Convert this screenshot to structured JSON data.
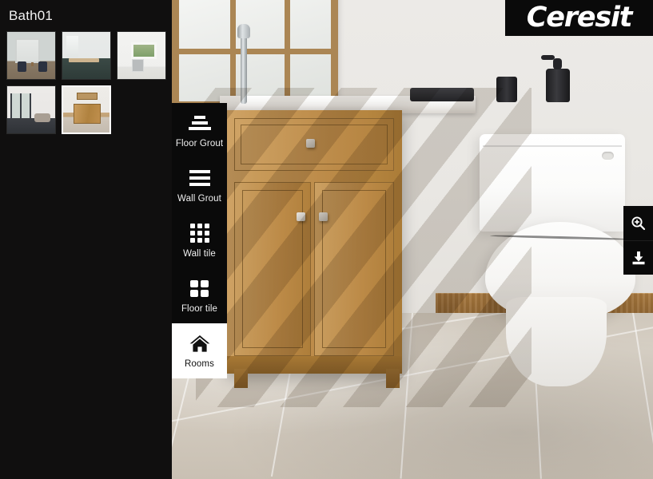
{
  "app": {
    "brand_logo_text": "Ceresit",
    "brand_bg": "#0a0a0a",
    "panel_bg": "#100f0f",
    "accent_active_bg": "#ffffff"
  },
  "sidebar": {
    "room_title": "Bath01",
    "thumbnails": [
      {
        "name": "living-room-fireplace",
        "selected": false,
        "art": "mini-livingroom"
      },
      {
        "name": "kitchen-dining",
        "selected": false,
        "art": "mini-kitchen-dining"
      },
      {
        "name": "white-kitchen",
        "selected": false,
        "art": "mini-white-kitchen"
      },
      {
        "name": "loft-living",
        "selected": false,
        "art": "mini-loft"
      },
      {
        "name": "bathroom-vanity",
        "selected": true,
        "art": "mini-bath"
      }
    ]
  },
  "tool_menu": {
    "items": [
      {
        "label": "Floor Grout",
        "icon": "floor-grout-icon",
        "active": false
      },
      {
        "label": "Wall Grout",
        "icon": "wall-grout-icon",
        "active": false
      },
      {
        "label": "Wall tile",
        "icon": "wall-tile-grid-icon",
        "active": false
      },
      {
        "label": "Floor tile",
        "icon": "floor-tile-grid-icon",
        "active": false
      },
      {
        "label": "Rooms",
        "icon": "home-icon",
        "active": true
      }
    ]
  },
  "right_tools": {
    "items": [
      {
        "name": "zoom-in-button",
        "icon": "magnifier-plus-icon"
      },
      {
        "name": "download-button",
        "icon": "download-icon"
      }
    ]
  },
  "scene": {
    "name": "bathroom-render",
    "description": "Bathroom visualization with wooden vanity, window, toilet and tiled floor",
    "colors": {
      "wall": "#e9e7e3",
      "floor_tile": "#d2cabe",
      "grout": "#ffffff",
      "wood_vanity": "#bd8c4a",
      "baseboard_wood": "#9c6f38",
      "ceramic_white": "#fbfbfa"
    }
  }
}
